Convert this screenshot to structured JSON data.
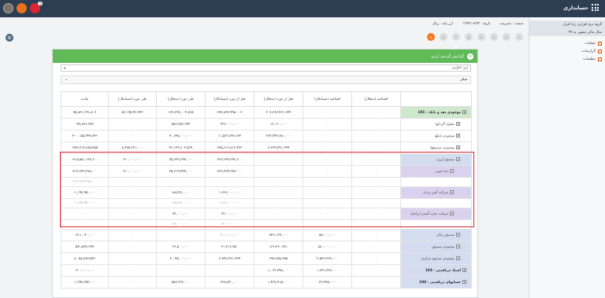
{
  "app": {
    "brand": "حسابداری"
  },
  "topbar": {
    "badge_orange": "",
    "badge_red": "0"
  },
  "sidebar": {
    "items": [
      {
        "label": "گروه نرم افزاری رایا افزار",
        "active": true
      },
      {
        "label": "سال مالی منتهی به ۹۹",
        "active": true
      },
      {
        "label": "عملیات"
      },
      {
        "label": "گزارشات"
      },
      {
        "label": "تنظیمات"
      }
    ]
  },
  "meta": {
    "role": "سمت : مدیریت",
    "date": "تاریخ : ۱۳۹۹/۰۷/۲۳",
    "base": "ارز پایه : ریال"
  },
  "stepper": {
    "steps": [
      "۱",
      "۲",
      "۳",
      "۴",
      "۵",
      "۶",
      "۷",
      "۸"
    ]
  },
  "report": {
    "title": "گزارش گردش ارزی",
    "currency_label": "ارز: امارتی",
    "filter_label": "فیلتر",
    "columns": [
      "افتتاحیه (بدهکار)",
      "افتتاحیه (بستانکار)",
      "قبل از دوره (بدهکار)",
      "قبل از دوره (بستانکار)",
      "طی دوره (بدهکار)",
      "طی دوره (بستانکار)",
      "مانده"
    ],
    "rows": [
      {
        "name": "101 - موجودی نقد و بانک",
        "cls": "g",
        "level": "",
        "v": [
          "۰",
          "۰",
          "۳۰۷,۳۶۷,۴۶۱,۶۳۴",
          "۳۷۷,۸۳۷,۹۹۸,۰۰۳",
          "۱۳۷,۳۳۷,۰۰۴,۸۶۵",
          "۵۳,۱۳۵,۴۳,۹۲۳",
          "۷۵,۸۳۱,۶۹۱,۸۰۳"
        ]
      },
      {
        "name": "تنخواه گردانها",
        "cls": "",
        "level": "sub",
        "v": [
          "۰",
          "۰",
          "۱۳,۰۲۰,۰۰۰",
          "۲۲۲,۰۰۰,۰۰۰",
          "۵۸۳,۳۵۶,۲۴۴",
          "۰",
          "-۴۷,۸۳۶,۷۷۳"
        ]
      },
      {
        "name": "موجودی بانکها",
        "cls": "",
        "level": "sub",
        "v": [
          "۰",
          "۰",
          "۲۶۴,۴۴۳,۶۵۰,۰۰۰",
          "۱۱,۵۶۲,۷۴۳,۶۳۲",
          "۹۰,۶۴۵,۰۰۰,۰۰۰",
          "۰",
          "۴۰۰,۰۵۵,۳۴۹,۷۳۳"
        ]
      },
      {
        "name": "موجودی صندوقها",
        "cls": "",
        "level": "sub",
        "v": [
          "۰",
          "۰",
          "۳,۳۶۹,۴۹۱,۶۹۹",
          "۳۷۵,۶۱۲,۸۱۲,۴۳۲",
          "۴۶,۱۴۳,۶۰۳,۵۶۹",
          "۸,۴۷۵,۶۲۱,۰۰۰",
          "-۳۷۳,۷۱۴,۶۸۵,۹۵۵"
        ]
      },
      {
        "name": "صندوق ارزی",
        "cls": "b",
        "level": "sub",
        "v": [
          "۰",
          "۰",
          "۰",
          "۳۶۳,۲۹۹,۳۹۶,۶۰۰",
          "۴۵,۶۲۹,۶۹۹,۰۰۰",
          "۲۱۰,۰۰۰,۰۰۰",
          "-۳۱۸,۵۸۱,۱۳۷,۶۰۰"
        ]
      },
      {
        "name": "دینا حبیبی",
        "cls": "p",
        "level": "sub2",
        "v": [
          "۰",
          "۰",
          "۰",
          "۳۶۳,۳۳۴,۳۷۷,۰۰۰",
          "۲۵,۳۱۹,۴۹۹,۰۰۰",
          "۲۱۰,۰۰۰,۰۰۰",
          "-۳۱۷,۳۳۳,۲۷۸,۰۰۰"
        ],
        "sub": [
          "",
          "",
          "",
          "",
          "",
          "",
          "-۳۱۷,۳۳۳,۲۷۸,۰۰۰"
        ]
      },
      {
        "name": "شرکت آیس پرداز",
        "cls": "p",
        "level": "sub2",
        "v": [
          "۰",
          "۰",
          "۰",
          "۱,۳۶۷,۰۰۰,۰۰۰",
          "۱۸۵,۲۵۰,۰۰۰",
          "۰",
          "-۱,۱۹۷,۹۵۰,۰۰۰"
        ],
        "sub": [
          "",
          "",
          "",
          "۱,۳۶۷,۰۰۰,۰۰۰",
          "۱۸۵,۲۵۰,۰۰۰",
          "",
          "-۱,۱۹۷,۹۵۰,۰۰۰"
        ]
      },
      {
        "name": "شرکت سازه گستر ایرانیان",
        "cls": "p",
        "level": "sub2",
        "v": [
          "۰",
          "۰",
          "۰",
          "۷۲,۰۰۰,۰۰۰",
          "۷۲,۰۰۰,۰۰۰",
          "۰",
          "۰"
        ],
        "sub": [
          "",
          "",
          "",
          "۷۲,۰۰۰,۰۰۰",
          "۷۲,۰۰۰,۰۰۰",
          "",
          "۰"
        ]
      },
      {
        "name": "صندوق ریالی",
        "cls": "b",
        "level": "sub",
        "v": [
          "۰",
          "۸۵,۰۰۰,۰۰۰",
          "۸۴۶,۱۲۹,۰۰۰",
          "۱۰۰,۰۰۰,۰۰۰",
          "۰",
          "۰",
          "-۷۱۱,۰۹۰,۰۰۰"
        ]
      },
      {
        "name": "موجودی صندوق",
        "cls": "b",
        "level": "sub",
        "v": [
          "۰",
          "۸۸۰,۰۰۰,۰۰۰",
          "۱۳۶,۲۳۰,۴۳۱",
          "۴۱,۳۱۳,۹۵۰",
          "۴۶,۵۰۰,۰۰۰",
          "۰",
          "۵۹۱,۵۹۲,۳۹۹"
        ]
      },
      {
        "name": "موجودی صندوق مرکزی",
        "cls": "b",
        "level": "sub",
        "v": [
          "۰",
          "۲,۵۳۳,۳۳۹,۰۰۰",
          "۶۹۸,۳۵۸,۴۸۵",
          "۳,۳۴۷,۲۷۱,۹۳۹",
          "۲,۰۴۵,۰۰۰,۰۰۰",
          "۰",
          "۸,۰۵۸,۸۷۷,۵۴۶"
        ]
      },
      {
        "name": "103 - اسناد دریافتنی",
        "cls": "b",
        "level": "",
        "v": [
          "۰",
          "۱,۳۶۲,۲۳۷,۰۰۰",
          "۱,۰۶۲,۳۹۸,۰۰۰",
          "۰",
          "۰",
          "۰",
          "-۳۰۰,۰۰۰,۰۰۰"
        ]
      },
      {
        "name": "104 - حسابهای دریافتنی",
        "cls": "b",
        "level": "",
        "v": [
          "۰",
          "۳۳,۴۷۵,۰۰۰",
          "۱,۴۶۹,۴۱۵,۰۰۰",
          "۲۳۸,۸۴۰,۰۰۰",
          "۵۸۳,۲۳۲,۰۰۰",
          "۰",
          "-۱,۳۹۷,۲۵۲,۰۰۰"
        ]
      }
    ]
  }
}
